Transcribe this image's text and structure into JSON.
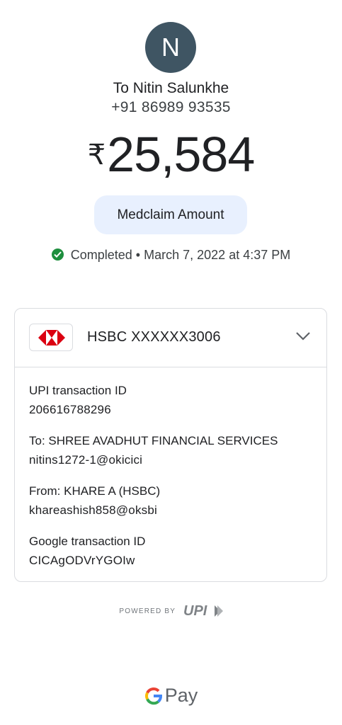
{
  "recipient": {
    "initial": "N",
    "name": "To Nitin Salunkhe",
    "phone": "+91 86989 93535"
  },
  "payment": {
    "currency_symbol": "₹",
    "amount": "25,584",
    "note": "Medclaim Amount",
    "status": "Completed",
    "separator": "•",
    "datetime": "March 7, 2022 at 4:37 PM"
  },
  "bank": {
    "name": "HSBC XXXXXX3006",
    "logo_icon": "hsbc-logo-icon"
  },
  "details": {
    "upi_label": "UPI transaction ID",
    "upi_value": "206616788296",
    "to_label": "To: SHREE AVADHUT FINANCIAL SERVICES",
    "to_value": "nitins1272-1@okicici",
    "from_label": "From: KHARE A (HSBC)",
    "from_value": "khareashish858@oksbi",
    "google_label": "Google transaction ID",
    "google_value": "CICAgODVrYGOIw"
  },
  "footer": {
    "powered_by": "POWERED BY",
    "upi_logo_text": "UPI",
    "brand_pay": "Pay"
  },
  "colors": {
    "avatar_bg": "#3f5563",
    "chip_bg": "#e8f0fe",
    "status_green": "#1e8e3e",
    "hsbc_red": "#db0011"
  }
}
